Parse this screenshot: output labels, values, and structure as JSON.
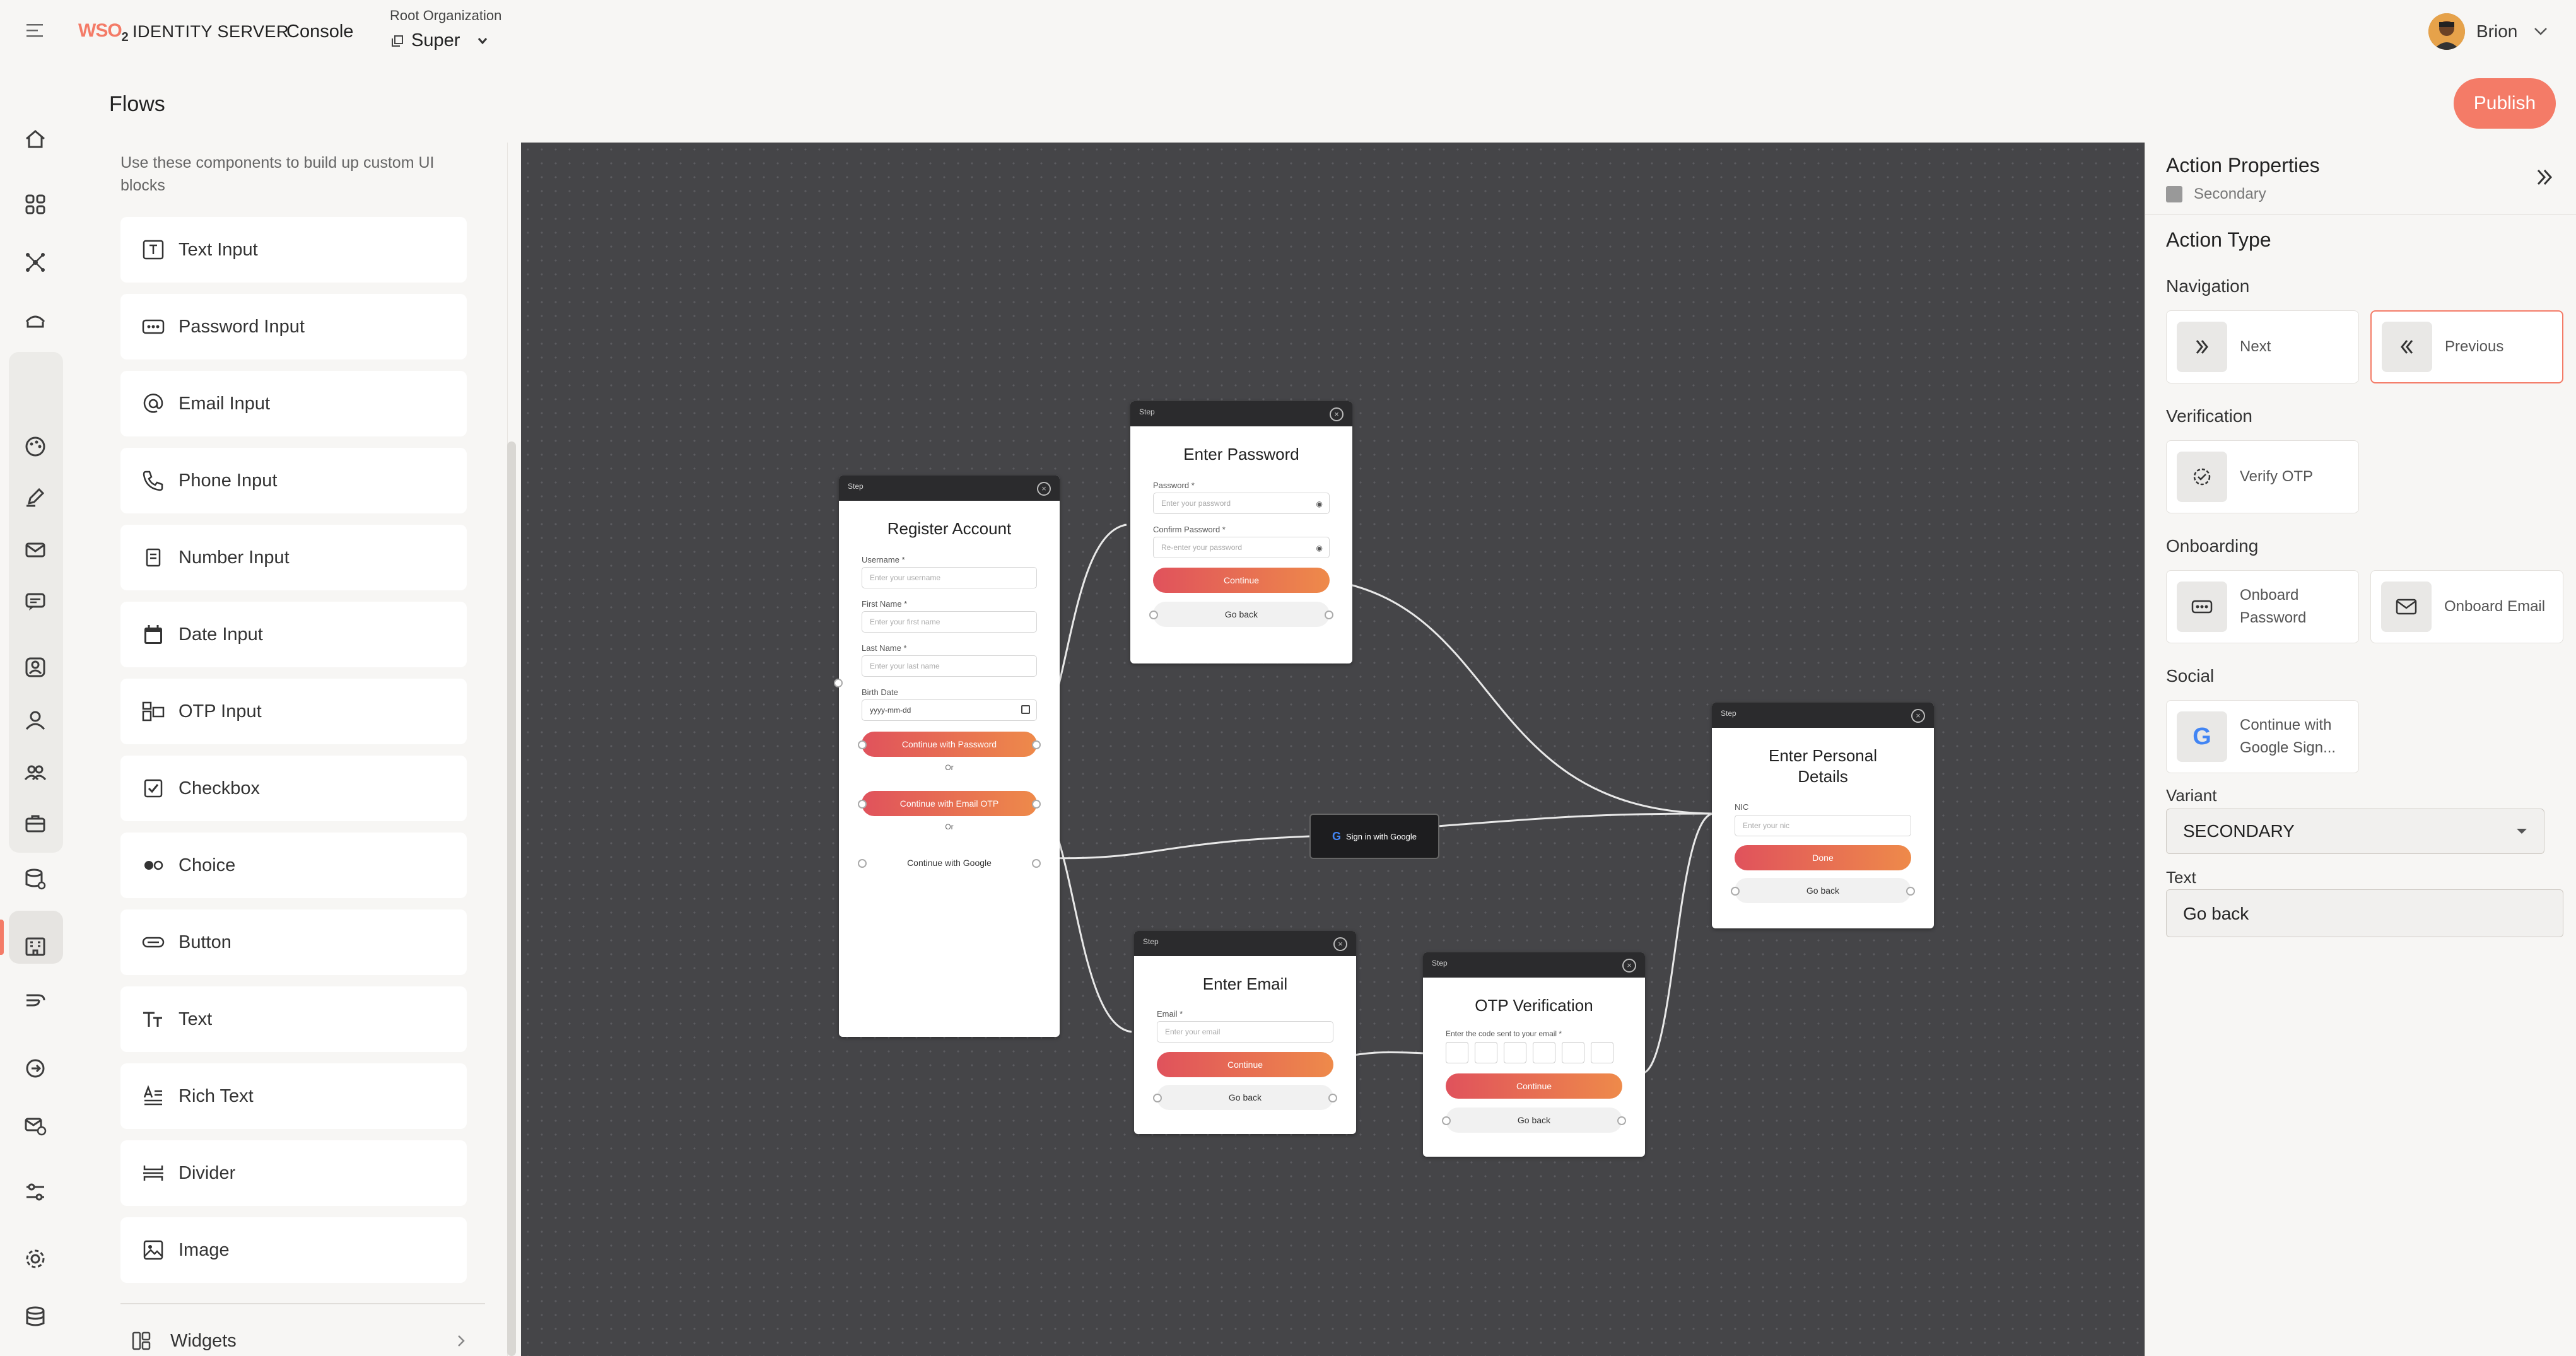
{
  "topbar": {
    "brand": "WSO",
    "brand_sup": "2",
    "product": "IDENTITY SERVER",
    "console": "Console",
    "org_label": "Root Organization",
    "org_name": "Super",
    "user_name": "Brion"
  },
  "header": {
    "title": "Flows",
    "publish": "Publish"
  },
  "nav": {
    "icons": [
      "home-icon",
      "apps-icon",
      "connections-icon",
      "user-attributes-icon",
      "branding-icon",
      "edit-icon",
      "mail-icon",
      "chat-icon",
      "organizations-icon",
      "user-icon",
      "groups-icon",
      "roles-icon",
      "workflows-icon",
      "building-icon",
      "flows-icon",
      "login-flow-icon",
      "email-provider-icon",
      "logs-icon",
      "settings-icon",
      "database-icon"
    ]
  },
  "palette": {
    "intro": "Use these components to build up custom UI blocks",
    "items": [
      {
        "label": "Text Input",
        "icon": "text-input-icon"
      },
      {
        "label": "Password Input",
        "icon": "password-input-icon"
      },
      {
        "label": "Email Input",
        "icon": "email-input-icon"
      },
      {
        "label": "Phone Input",
        "icon": "phone-input-icon"
      },
      {
        "label": "Number Input",
        "icon": "number-input-icon"
      },
      {
        "label": "Date Input",
        "icon": "date-input-icon"
      },
      {
        "label": "OTP Input",
        "icon": "otp-input-icon"
      },
      {
        "label": "Checkbox",
        "icon": "checkbox-icon"
      },
      {
        "label": "Choice",
        "icon": "choice-icon"
      },
      {
        "label": "Button",
        "icon": "button-icon"
      },
      {
        "label": "Text",
        "icon": "text-icon"
      },
      {
        "label": "Rich Text",
        "icon": "rich-text-icon"
      },
      {
        "label": "Divider",
        "icon": "divider-icon"
      },
      {
        "label": "Image",
        "icon": "image-icon"
      }
    ],
    "widgets": "Widgets"
  },
  "canvas": {
    "step_label": "Step",
    "register": {
      "title": "Register Account",
      "username_label": "Username *",
      "username_ph": "Enter your username",
      "firstname_label": "First Name *",
      "firstname_ph": "Enter your first name",
      "lastname_label": "Last Name *",
      "lastname_ph": "Enter your last name",
      "birth_label": "Birth Date",
      "birth_ph": "yyyy-mm-dd",
      "btn_password": "Continue with Password",
      "or1": "Or",
      "btn_email_otp": "Continue with Email OTP",
      "or2": "Or",
      "btn_google": "Continue with Google"
    },
    "password": {
      "title": "Enter Password",
      "password_label": "Password *",
      "password_ph": "Enter your password",
      "confirm_label": "Confirm Password *",
      "confirm_ph": "Re-enter your password",
      "continue": "Continue",
      "go_back": "Go back"
    },
    "google": {
      "label": "Sign in with Google"
    },
    "personal": {
      "title_line1": "Enter Personal",
      "title_line2": "Details",
      "nic_label": "NIC",
      "nic_ph": "Enter your nic",
      "done": "Done",
      "go_back": "Go back"
    },
    "email": {
      "title": "Enter Email",
      "email_label": "Email *",
      "email_ph": "Enter your email",
      "continue": "Continue",
      "go_back": "Go back"
    },
    "otp": {
      "title": "OTP Verification",
      "hint": "Enter the code sent to your email *",
      "continue": "Continue",
      "go_back": "Go back"
    }
  },
  "properties": {
    "title": "Action Properties",
    "subtitle": "Secondary",
    "action_type": "Action Type",
    "navigation": "Navigation",
    "next": "Next",
    "previous": "Previous",
    "verification": "Verification",
    "verify_otp": "Verify OTP",
    "onboarding": "Onboarding",
    "onboard_password": "Onboard Password",
    "onboard_email": "Onboard Email",
    "social": "Social",
    "google_signin": "Continue with Google Sign...",
    "variant_label": "Variant",
    "variant_value": "SECONDARY",
    "text_label": "Text",
    "text_value": "Go back"
  },
  "colors": {
    "accent": "#f47b67",
    "primary_gradient_start": "#e0525c",
    "primary_gradient_end": "#ee8a4a",
    "canvas_bg": "#454548"
  }
}
